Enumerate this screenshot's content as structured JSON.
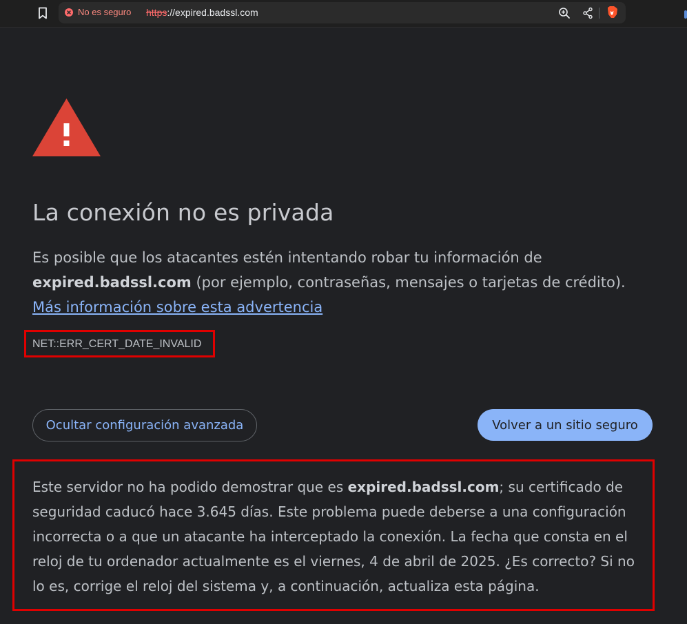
{
  "browser": {
    "security_label": "No es seguro",
    "url_scheme": "https",
    "url_rest": "://expired.badssl.com",
    "icons": [
      "bookmark-icon",
      "not-secure-icon",
      "zoom-icon",
      "share-icon",
      "brave-shield-icon"
    ]
  },
  "page": {
    "title": "La conexión no es privada",
    "desc_part1": "Es posible que los atacantes estén intentando robar tu información de ",
    "desc_domain": "expired.badssl.com",
    "desc_part2": " (por ejemplo, contraseñas, mensajes o tarjetas de crédito). ",
    "learn_more": "Más información sobre esta advertencia",
    "error_code": "NET::ERR_CERT_DATE_INVALID",
    "advanced_button": "Ocultar configuración avanzada",
    "back_button": "Volver a un sitio seguro",
    "details_part1": "Este servidor no ha podido demostrar que es ",
    "details_domain": "expired.badssl.com",
    "details_part2": "; su certificado de seguridad caducó hace 3.645 días. Este problema puede deberse a una configuración incorrecta o a que un atacante ha interceptado la conexión. La fecha que consta en el reloj de tu ordenador actualmente es el viernes, 4 de abril de 2025. ¿Es correcto? Si no lo es, corrige el reloj del sistema y, a continuación, actualiza esta página."
  },
  "colors": {
    "background": "#202124",
    "text": "#bdc1c6",
    "link": "#8ab4f8",
    "warning_icon": "#db4437",
    "highlight_border": "#e00000"
  }
}
